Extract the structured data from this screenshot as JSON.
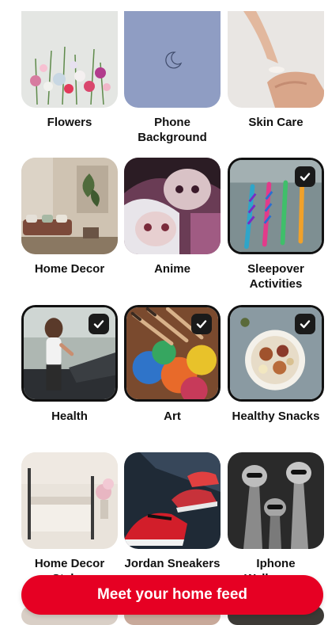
{
  "topics": [
    {
      "label": "Flowers",
      "selected": false
    },
    {
      "label": "Phone Background",
      "selected": false
    },
    {
      "label": "Skin Care",
      "selected": false
    },
    {
      "label": "Home Decor",
      "selected": false
    },
    {
      "label": "Anime",
      "selected": false
    },
    {
      "label": "Sleepover Activities",
      "selected": true
    },
    {
      "label": "Health",
      "selected": true
    },
    {
      "label": "Art",
      "selected": true
    },
    {
      "label": "Healthy Snacks",
      "selected": true
    },
    {
      "label": "Home Decor Styles",
      "selected": false
    },
    {
      "label": "Jordan Sneakers",
      "selected": false
    },
    {
      "label": "Iphone Wallpapers",
      "selected": false
    }
  ],
  "cta": {
    "label": "Meet your home feed",
    "color": "#e60023"
  },
  "icons": {
    "selected_check": "checkmark-icon",
    "moon": "moon-icon"
  }
}
